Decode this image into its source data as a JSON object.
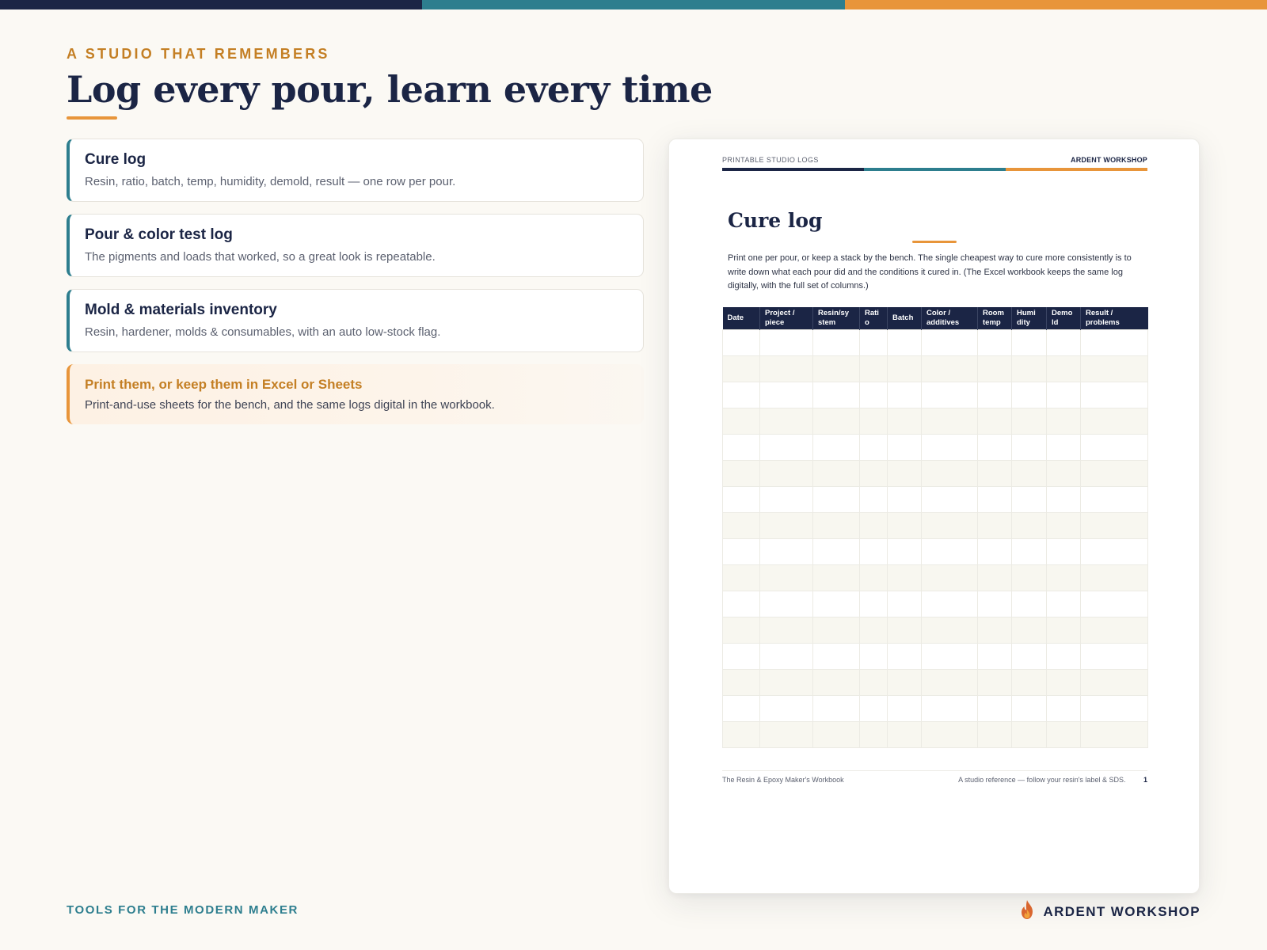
{
  "colors": {
    "navy": "#1b2545",
    "teal": "#2d7e8e",
    "orange": "#e8953a",
    "gold": "#c47f24",
    "cream": "#fbf9f4"
  },
  "eyebrow": "A STUDIO THAT REMEMBERS",
  "headline": "Log every pour, learn every time",
  "features": [
    {
      "title": "Cure log",
      "desc": "Resin, ratio, batch, temp, humidity, demold, result — one row per pour."
    },
    {
      "title": "Pour & color test log",
      "desc": "The pigments and loads that worked, so a great look is repeatable."
    },
    {
      "title": "Mold & materials inventory",
      "desc": "Resin, hardener, molds & consumables, with an auto low-stock flag."
    }
  ],
  "callout": {
    "title": "Print them, or keep them in Excel or Sheets",
    "desc": "Print-and-use sheets for the bench, and the same logs digital in the workbook."
  },
  "footer": {
    "tagline": "TOOLS FOR THE MODERN MAKER",
    "brand": "ARDENT WORKSHOP",
    "brand_icon": "flame-icon"
  },
  "document": {
    "header_left": "PRINTABLE STUDIO LOGS",
    "header_right": "ARDENT WORKSHOP",
    "title": "Cure log",
    "intro": "Print one per pour, or keep a stack by the bench. The single cheapest way to cure more consistently is to write down what each pour did and the conditions it cured in. (The Excel workbook keeps the same log digitally, with the full set of columns.)",
    "table": {
      "columns": [
        "Date",
        "Project / piece",
        "Resin/sy stem",
        "Rati o",
        "Batch",
        "Color / additives",
        "Room temp",
        "Humi dity",
        "Demo ld",
        "Result / problems"
      ],
      "blank_rows": 16
    },
    "footer_left": "The Resin & Epoxy Maker's Workbook",
    "footer_right": "A studio reference — follow your resin's label & SDS.",
    "page_number": "1"
  }
}
